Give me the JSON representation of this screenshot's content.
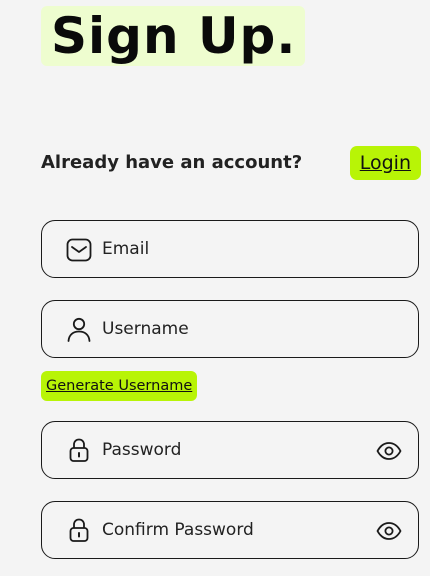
{
  "header": {
    "title": "Sign Up."
  },
  "account": {
    "prompt": "Already have an account?",
    "login_label": "Login"
  },
  "fields": {
    "email_placeholder": "Email",
    "username_placeholder": "Username",
    "password_placeholder": "Password",
    "confirm_password_placeholder": "Confirm Password"
  },
  "actions": {
    "generate_username_label": "Generate Username"
  },
  "icons": {
    "email": "mail-icon",
    "username": "user-icon",
    "password": "lock-icon",
    "confirm_password": "lock-icon",
    "toggle_visibility": "eye-icon"
  },
  "colors": {
    "accent": "#b8f406",
    "title_highlight": "#eefdcf",
    "background": "#f4f4f4",
    "text": "#1a1a1a"
  }
}
